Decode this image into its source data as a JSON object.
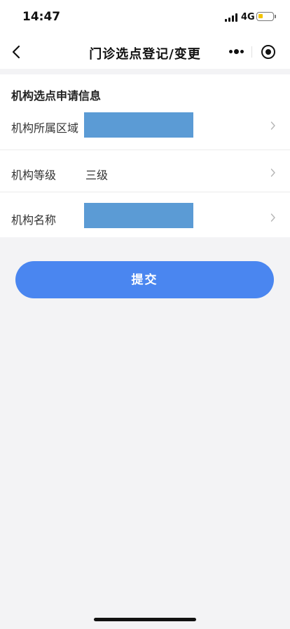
{
  "status_bar": {
    "time": "14:47",
    "network": "4G",
    "battery_level": 0.3,
    "battery_color": "#f3c400"
  },
  "nav": {
    "title": "门诊选点登记/变更",
    "back_icon": "chevron-left-icon",
    "more_icon": "more-dots-icon",
    "close_icon": "target-circle-icon"
  },
  "form": {
    "section_title": "机构选点申请信息",
    "rows": [
      {
        "label": "机构所属区域",
        "value": "",
        "redacted": true
      },
      {
        "label": "机构等级",
        "value": "三级",
        "redacted": false
      },
      {
        "label": "机构名称",
        "value": "",
        "redacted": true
      }
    ],
    "redaction_color": "#5b9bd5"
  },
  "actions": {
    "submit_label": "提交",
    "submit_color": "#4a86f0"
  }
}
